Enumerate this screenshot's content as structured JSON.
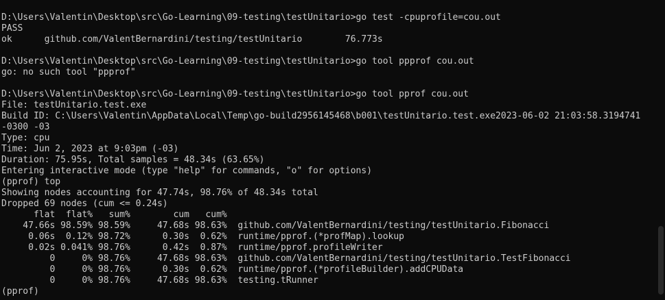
{
  "terminal": {
    "lines": [
      "",
      "D:\\Users\\Valentin\\Desktop\\src\\Go-Learning\\09-testing\\testUnitario>go test -cpuprofile=cou.out",
      "PASS",
      "ok      github.com/ValentBernardini/testing/testUnitario        76.773s",
      "",
      "D:\\Users\\Valentin\\Desktop\\src\\Go-Learning\\09-testing\\testUnitario>go tool ppprof cou.out",
      "go: no such tool \"ppprof\"",
      "",
      "D:\\Users\\Valentin\\Desktop\\src\\Go-Learning\\09-testing\\testUnitario>go tool pprof cou.out",
      "File: testUnitario.test.exe",
      "Build ID: C:\\Users\\Valentin\\AppData\\Local\\Temp\\go-build2956145468\\b001\\testUnitario.test.exe2023-06-02 21:03:58.3194741",
      "-0300 -03",
      "Type: cpu",
      "Time: Jun 2, 2023 at 9:03pm (-03)",
      "Duration: 75.95s, Total samples = 48.34s (63.65%)",
      "Entering interactive mode (type \"help\" for commands, \"o\" for options)",
      "(pprof) top",
      "Showing nodes accounting for 47.74s, 98.76% of 48.34s total",
      "Dropped 69 nodes (cum <= 0.24s)",
      "      flat  flat%   sum%        cum   cum%",
      "    47.66s 98.59% 98.59%     47.68s 98.63%  github.com/ValentBernardini/testing/testUnitario.Fibonacci",
      "     0.06s  0.12% 98.72%      0.30s  0.62%  runtime/pprof.(*profMap).lookup",
      "     0.02s 0.041% 98.76%      0.42s  0.87%  runtime/pprof.profileWriter",
      "         0     0% 98.76%     47.68s 98.63%  github.com/ValentBernardini/testing/testUnitario.TestFibonacci",
      "         0     0% 98.76%      0.30s  0.62%  runtime/pprof.(*profileBuilder).addCPUData",
      "         0     0% 98.76%     47.68s 98.63%  testing.tRunner",
      "(pprof)"
    ]
  }
}
